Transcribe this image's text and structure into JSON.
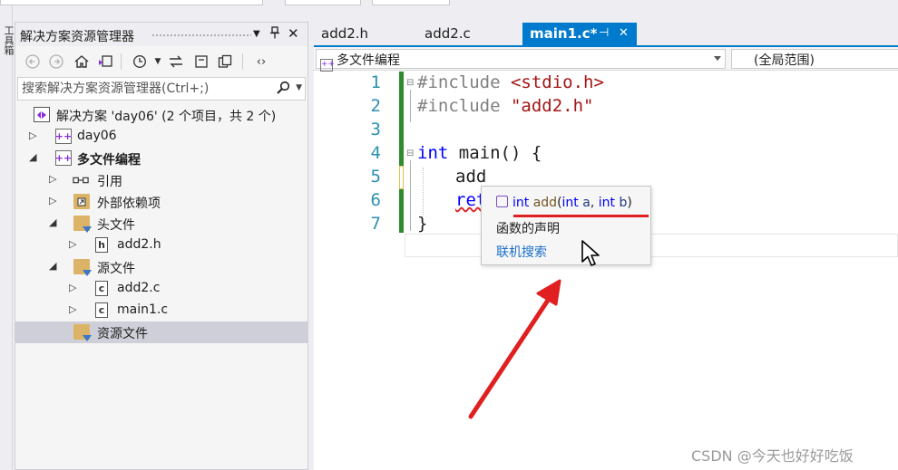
{
  "toolbox_strip": {
    "label": "工具箱"
  },
  "solution_explorer": {
    "title": "解决方案资源管理器",
    "pin_glyph": "📌",
    "search_placeholder": "搜索解决方案资源管理器(Ctrl+;)",
    "tree": [
      {
        "label": "解决方案 'day06' (2 个项目，共 2 个)",
        "bold": false
      },
      {
        "label": "day06",
        "bold": false
      },
      {
        "label": "多文件编程",
        "bold": true
      },
      {
        "label": "引用",
        "bold": false
      },
      {
        "label": "外部依赖项",
        "bold": false
      },
      {
        "label": "头文件",
        "bold": false
      },
      {
        "label": "add2.h",
        "bold": false,
        "icon_text": "h"
      },
      {
        "label": "源文件",
        "bold": false
      },
      {
        "label": "add2.c",
        "bold": false,
        "icon_text": "c"
      },
      {
        "label": "main1.c",
        "bold": false,
        "icon_text": "c"
      },
      {
        "label": "资源文件",
        "bold": false
      }
    ]
  },
  "editor": {
    "tabs": [
      {
        "label": "add2.h",
        "active": false
      },
      {
        "label": "add2.c",
        "active": false
      },
      {
        "label": "main1.c*",
        "active": true
      }
    ],
    "nav_project": "多文件编程",
    "nav_scope": "(全局范围)",
    "line_numbers": [
      "1",
      "2",
      "3",
      "4",
      "5",
      "6",
      "7"
    ],
    "code": {
      "l1_directive": "#include",
      "l1_header": "<stdio.h>",
      "l2_directive": "#include",
      "l2_header": "\"add2.h\"",
      "l4_type": "int",
      "l4_rest": " main() {",
      "l5_text": "add",
      "l6_text": "ret",
      "l7_text": "}"
    }
  },
  "intellisense": {
    "sig_ret": "int",
    "sig_name": "add",
    "sig_open": "(",
    "sig_p1_type": "int",
    "sig_p1_name": "a",
    "sig_comma": ", ",
    "sig_p2_type": "int",
    "sig_p2_name": "b",
    "sig_close": ")",
    "description": "函数的声明",
    "online_search": "联机搜索"
  },
  "watermark": "CSDN @今天也好好吃饭",
  "colors": {
    "accent": "#007acc",
    "annotation_red": "#e02020",
    "change_bar": "#2e8b2e"
  }
}
